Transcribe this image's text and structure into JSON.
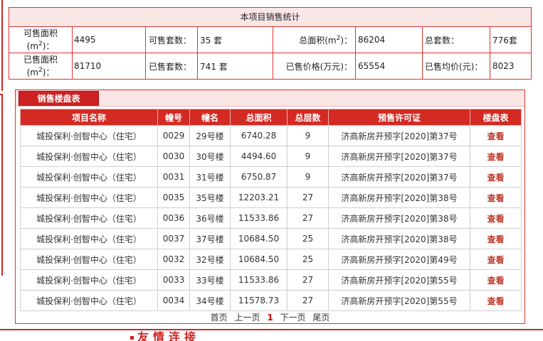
{
  "stats": {
    "title": "本项目销售统计",
    "row1": {
      "available_area_label": "可售面积",
      "available_area_unit": "(m",
      "available_area_unit_end": ")：",
      "available_area_value": "4495",
      "available_units_label": "可售套数：",
      "available_units_value": "35 套",
      "total_area_label": "总面积(m",
      "total_area_label_end": ")：",
      "total_area_value": "86204",
      "total_units_label": "总套数：",
      "total_units_value": "776套"
    },
    "row2": {
      "sold_area_label": "已售面积",
      "sold_area_unit": "(m",
      "sold_area_unit_end": ")：",
      "sold_area_value": "81710",
      "sold_units_label": "已售套数：",
      "sold_units_value": "741 套",
      "sold_price_label": "已售价格(万元)：",
      "sold_price_value": "65554",
      "avg_price_label": "已售均价(元)：",
      "avg_price_value": "8023"
    },
    "sup": "2"
  },
  "panel": {
    "tab_label": "销售楼盘表",
    "headers": [
      "项目名称",
      "幢号",
      "幢名",
      "总面积",
      "总层数",
      "预售许可证",
      "楼盘表"
    ],
    "rows": [
      [
        "城投保利·创智中心（住宅）",
        "0029",
        "29号楼",
        "6740.28",
        "9",
        "济高新房开预字[2020]第37号",
        "查看"
      ],
      [
        "城投保利·创智中心（住宅）",
        "0030",
        "30号楼",
        "4494.60",
        "9",
        "济高新房开预字[2020]第37号",
        "查看"
      ],
      [
        "城投保利·创智中心（住宅）",
        "0031",
        "31号楼",
        "6750.87",
        "9",
        "济高新房开预字[2020]第37号",
        "查看"
      ],
      [
        "城投保利·创智中心（住宅）",
        "0035",
        "35号楼",
        "12203.21",
        "27",
        "济高新房开预字[2020]第38号",
        "查看"
      ],
      [
        "城投保利·创智中心（住宅）",
        "0036",
        "36号楼",
        "11533.86",
        "27",
        "济高新房开预字[2020]第38号",
        "查看"
      ],
      [
        "城投保利·创智中心（住宅）",
        "0037",
        "37号楼",
        "10684.50",
        "25",
        "济高新房开预字[2020]第38号",
        "查看"
      ],
      [
        "城投保利·创智中心（住宅）",
        "0032",
        "32号楼",
        "10684.50",
        "25",
        "济高新房开预字[2020]第49号",
        "查看"
      ],
      [
        "城投保利·创智中心（住宅）",
        "0033",
        "33号楼",
        "11533.86",
        "27",
        "济高新房开预字[2020]第55号",
        "查看"
      ],
      [
        "城投保利·创智中心（住宅）",
        "0034",
        "34号楼",
        "11578.73",
        "27",
        "济高新房开预字[2020]第55号",
        "查看"
      ]
    ],
    "pager": {
      "first": "首页",
      "prev": "上一页",
      "current": "1",
      "next": "下一页",
      "last": "尾页"
    }
  },
  "footer": {
    "friend_links_title": "友情连接"
  },
  "colors": {
    "accent_red": "#d42a24",
    "light_pink": "#fbe6e6",
    "link_red": "#c0392b"
  }
}
